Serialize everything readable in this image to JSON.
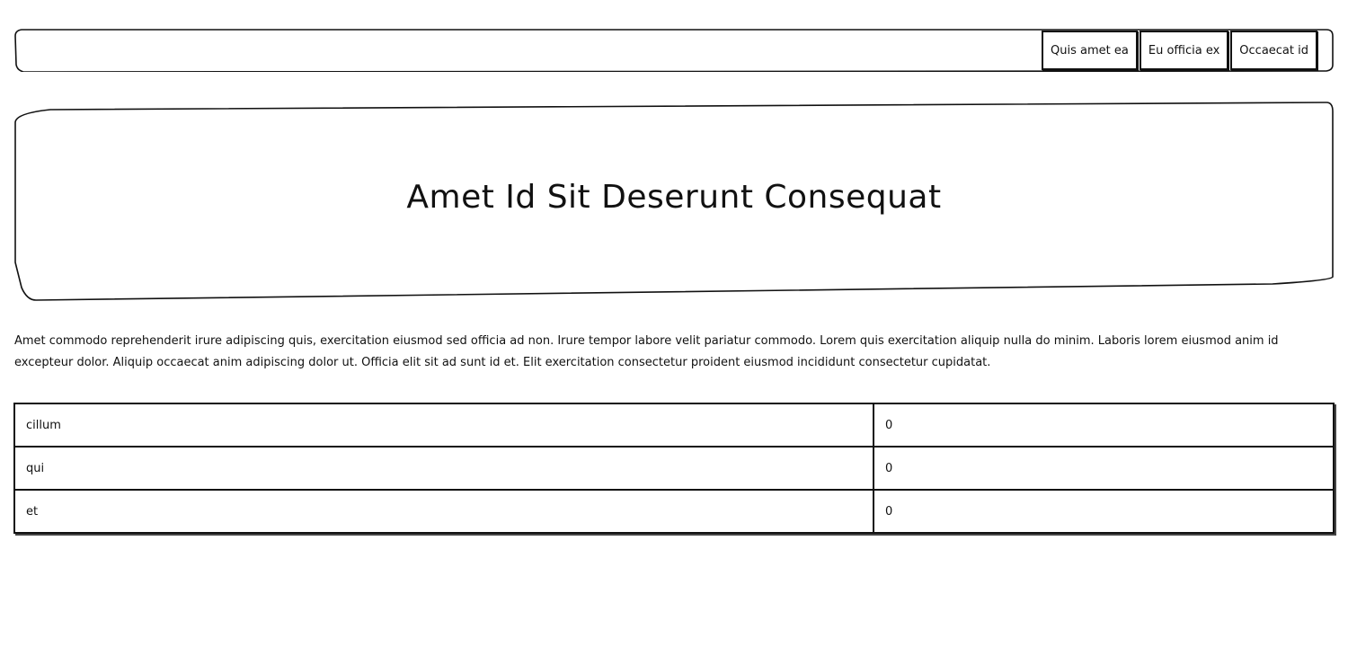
{
  "nav": {
    "buttons": [
      "Quis amet ea",
      "Eu officia ex",
      "Occaecat id"
    ]
  },
  "hero": {
    "title": "Amet Id Sit Deserunt Consequat"
  },
  "body": {
    "paragraph": "Amet commodo reprehenderit irure adipiscing quis, exercitation eiusmod sed officia ad non. Irure tempor labore velit pariatur commodo. Lorem quis exercitation aliquip nulla do minim. Laboris lorem eiusmod anim id excepteur dolor. Aliquip occaecat anim adipiscing dolor ut. Officia elit sit ad sunt id et. Elit exercitation consectetur proident eiusmod incididunt consectetur cupidatat."
  },
  "table": {
    "rows": [
      [
        "cillum",
        "0"
      ],
      [
        "qui",
        "0"
      ],
      [
        "et",
        "0"
      ]
    ]
  }
}
